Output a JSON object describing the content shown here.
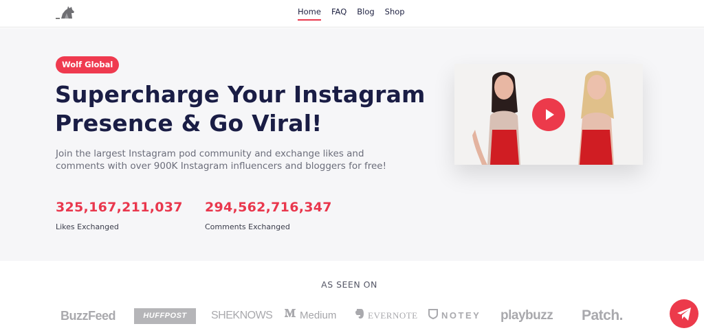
{
  "nav": {
    "items": [
      {
        "label": "Home",
        "active": true
      },
      {
        "label": "FAQ",
        "active": false
      },
      {
        "label": "Blog",
        "active": false
      },
      {
        "label": "Shop",
        "active": false
      }
    ]
  },
  "hero": {
    "badge": "Wolf Global",
    "headline_line1": "Supercharge Your Instagram",
    "headline_line2": "Presence & Go Viral!",
    "subtitle_line1": "Join the largest Instagram pod community and exchange likes and",
    "subtitle_line2": "comments with over 900K Instagram influencers and bloggers for free!",
    "stats": [
      {
        "value": "325,167,211,037",
        "label": "Likes Exchanged"
      },
      {
        "value": "294,562,716,347",
        "label": "Comments Exchanged"
      }
    ]
  },
  "as_seen_on": {
    "title": "AS SEEN ON",
    "logos": [
      "BuzzFeed",
      "HUFFPOST",
      "SHEKNOWS",
      "Medium",
      "EVERNOTE",
      "NOTEY",
      "playbuzz",
      "Patch."
    ]
  },
  "colors": {
    "accent": "#e9374d",
    "navy": "#1a1d45",
    "hero_bg": "#f6f6f8"
  },
  "icons": {
    "logo": "wolf-logo-icon",
    "play": "play-icon",
    "fab": "telegram-paper-plane-icon"
  }
}
